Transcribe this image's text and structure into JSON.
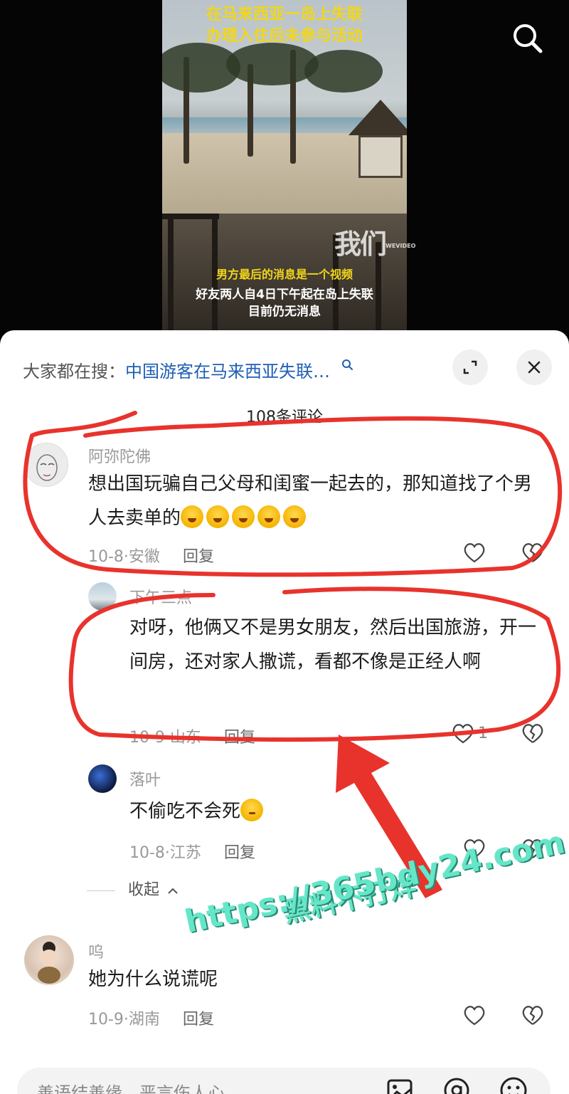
{
  "video": {
    "caption_top": [
      "在马来西亚一岛上失联",
      "办理入住后未参与活动"
    ],
    "caption_yellow": "男方最后的消息是一个视频",
    "caption_white": [
      "好友两人自4日下午起在岛上失联",
      "目前仍无消息"
    ],
    "logo_text": "我们",
    "logo_small": "WEVIDEO"
  },
  "sheet": {
    "search_prefix": "大家都在搜：",
    "search_link": "中国游客在马来西亚失联…",
    "count": "108条评论"
  },
  "comments": [
    {
      "user": "阿弥陀佛",
      "text": "想出国玩骗自己父母和闺蜜一起去的，那知道找了个男人去卖单的",
      "date_region": "10-8·安徽",
      "reply": "回复"
    },
    {
      "user": "下午三点",
      "text": "对呀，他俩又不是男女朋友，然后出国旅游，开一间房，还对家人撒谎，看都不像是正经人啊",
      "date_region": "10-9·山东",
      "reply": "回复",
      "likes": "1"
    },
    {
      "user": "落叶",
      "text": "不偷吃不会死",
      "date_region": "10-8·江苏",
      "reply": "回复"
    },
    {
      "user": "呜",
      "text": "她为什么说谎呢",
      "date_region": "10-9·湖南",
      "reply": "回复"
    }
  ],
  "collapse_label": "收起",
  "input_placeholder": "善语结善缘，恶言伤人心",
  "promo": {
    "line1": "黑料不打烊",
    "line2": "https://365bdy24.com"
  },
  "colors": {
    "link": "#1e5fb3",
    "caption_yellow": "#f2d61a",
    "annotation_red": "#e8332c",
    "promo_green": "#66e6c8"
  }
}
